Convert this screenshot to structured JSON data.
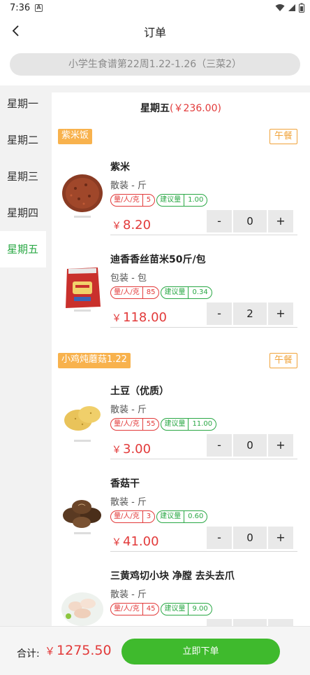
{
  "status": {
    "time": "7:36"
  },
  "header": {
    "title": "订单"
  },
  "menu_selector": {
    "label": "小学生食谱第22周1.22-1.26（三菜2）"
  },
  "sidebar": {
    "items": [
      {
        "label": "星期一"
      },
      {
        "label": "星期二"
      },
      {
        "label": "星期三"
      },
      {
        "label": "星期四"
      },
      {
        "label": "星期五"
      }
    ],
    "active_index": 4
  },
  "day": {
    "name": "星期五",
    "price_open": "(",
    "price": "￥236.00",
    "price_close": ")"
  },
  "dishes": [
    {
      "name": "紫米饭",
      "meal": "午餐",
      "products": [
        {
          "name": "紫米",
          "spec": "散装 - 斤",
          "per_person_label": "量/人/克",
          "per_person": "5",
          "suggest_label": "建议量",
          "suggest": "1.00",
          "currency": "￥",
          "price": "8.20",
          "qty": "0"
        },
        {
          "name": "迪香香丝苗米50斤/包",
          "spec": "包装 - 包",
          "per_person_label": "量/人/克",
          "per_person": "85",
          "suggest_label": "建议量",
          "suggest": "0.34",
          "currency": "￥",
          "price": "118.00",
          "qty": "2"
        }
      ]
    },
    {
      "name": "小鸡炖蘑菇1.22",
      "meal": "午餐",
      "products": [
        {
          "name": "土豆（优质）",
          "spec": "散装 - 斤",
          "per_person_label": "量/人/克",
          "per_person": "55",
          "suggest_label": "建议量",
          "suggest": "11.00",
          "currency": "￥",
          "price": "3.00",
          "qty": "0"
        },
        {
          "name": "香菇干",
          "spec": "散装 - 斤",
          "per_person_label": "量/人/克",
          "per_person": "3",
          "suggest_label": "建议量",
          "suggest": "0.60",
          "currency": "￥",
          "price": "41.00",
          "qty": "0"
        },
        {
          "name": "三黄鸡切小块 净膛 去头去爪",
          "spec": "散装 - 斤",
          "per_person_label": "量/人/克",
          "per_person": "45",
          "suggest_label": "建议量",
          "suggest": "9.00"
        }
      ]
    }
  ],
  "stepper": {
    "minus": "-",
    "plus": "+"
  },
  "footer": {
    "total_label": "合计:",
    "currency": "￥",
    "total": "1275.50",
    "order_button": "立即下单"
  },
  "colors": {
    "accent_green": "#3fba2d",
    "price_red": "#e23a3a",
    "tag_orange": "#f8b24d"
  }
}
